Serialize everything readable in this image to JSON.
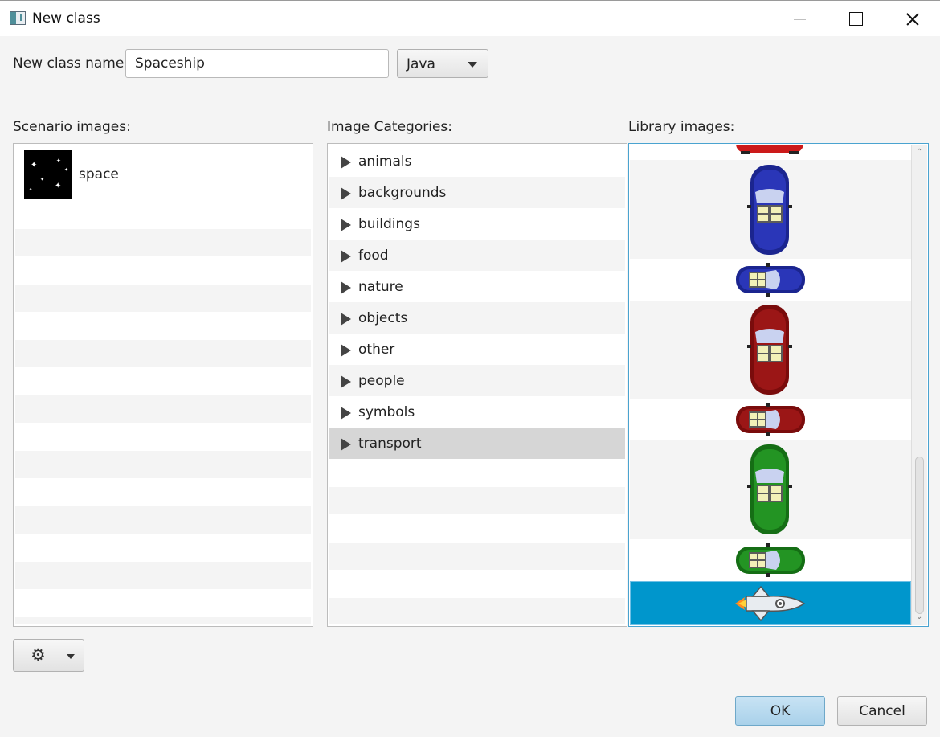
{
  "window": {
    "title": "New class"
  },
  "form": {
    "class_name_label": "New class name:",
    "class_name_value": "Spaceship",
    "language_selected": "Java"
  },
  "scenario": {
    "label": "Scenario images:",
    "items": [
      {
        "label": "space",
        "icon": "space-starfield-thumbnail"
      }
    ]
  },
  "categories": {
    "label": "Image Categories:",
    "selected": "transport",
    "items": [
      {
        "label": "animals"
      },
      {
        "label": "backgrounds"
      },
      {
        "label": "buildings"
      },
      {
        "label": "food"
      },
      {
        "label": "nature"
      },
      {
        "label": "objects"
      },
      {
        "label": "other"
      },
      {
        "label": "people"
      },
      {
        "label": "symbols"
      },
      {
        "label": "transport"
      }
    ]
  },
  "library": {
    "label": "Library images:",
    "items": [
      {
        "icon": "red-car-icon",
        "orientation": "horizontal"
      },
      {
        "icon": "blue-car-icon",
        "orientation": "vertical"
      },
      {
        "icon": "blue-car-icon",
        "orientation": "horizontal"
      },
      {
        "icon": "red-car-icon",
        "orientation": "vertical"
      },
      {
        "icon": "red-car-icon",
        "orientation": "horizontal"
      },
      {
        "icon": "green-car-icon",
        "orientation": "vertical"
      },
      {
        "icon": "green-car-icon",
        "orientation": "horizontal"
      },
      {
        "icon": "rocket-icon",
        "orientation": "horizontal",
        "selected": true
      }
    ]
  },
  "buttons": {
    "ok": "OK",
    "cancel": "Cancel"
  },
  "colors": {
    "selection_blue": "#0096cc",
    "ok_button": "#b4d9ef",
    "blue_car": "#1e2a9c",
    "red_car": "#8e1010",
    "green_car": "#1f8a1f"
  }
}
